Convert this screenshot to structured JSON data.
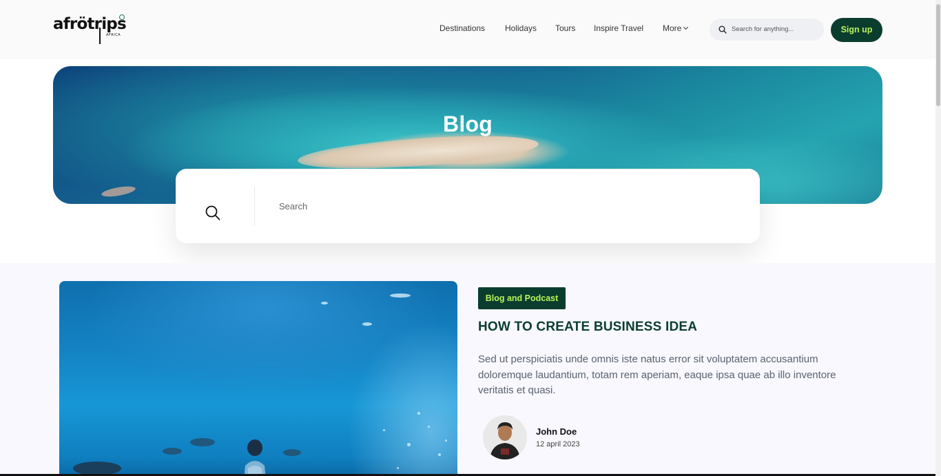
{
  "brand": {
    "logo_text": "afrötrips",
    "logo_sub": "AFRICA"
  },
  "nav": {
    "items": [
      {
        "label": "Destinations"
      },
      {
        "label": "Holidays"
      },
      {
        "label": "Tours"
      },
      {
        "label": "Inspire Travel"
      },
      {
        "label": "More"
      }
    ]
  },
  "header_search": {
    "placeholder": "Search for anything..."
  },
  "signup": {
    "label": "Sign up"
  },
  "hero": {
    "title": "Blog"
  },
  "blog_search": {
    "placeholder": "Search"
  },
  "post": {
    "category": "Blog and Podcast",
    "title": "HOW TO CREATE BUSINESS IDEA",
    "excerpt": "Sed ut perspiciatis unde omnis iste natus error sit voluptatem accusantium doloremque laudantium, totam rem aperiam, eaque ipsa quae ab illo inventore veritatis et quasi.",
    "author": {
      "name": "John Doe",
      "date": "12 april 2023"
    }
  },
  "colors": {
    "brand_dark": "#0b3d2e",
    "brand_lime": "#b8f35a",
    "title_green": "#0b3d2e"
  },
  "icons": {
    "search": "search-icon",
    "chevron": "chevron-down-icon"
  }
}
